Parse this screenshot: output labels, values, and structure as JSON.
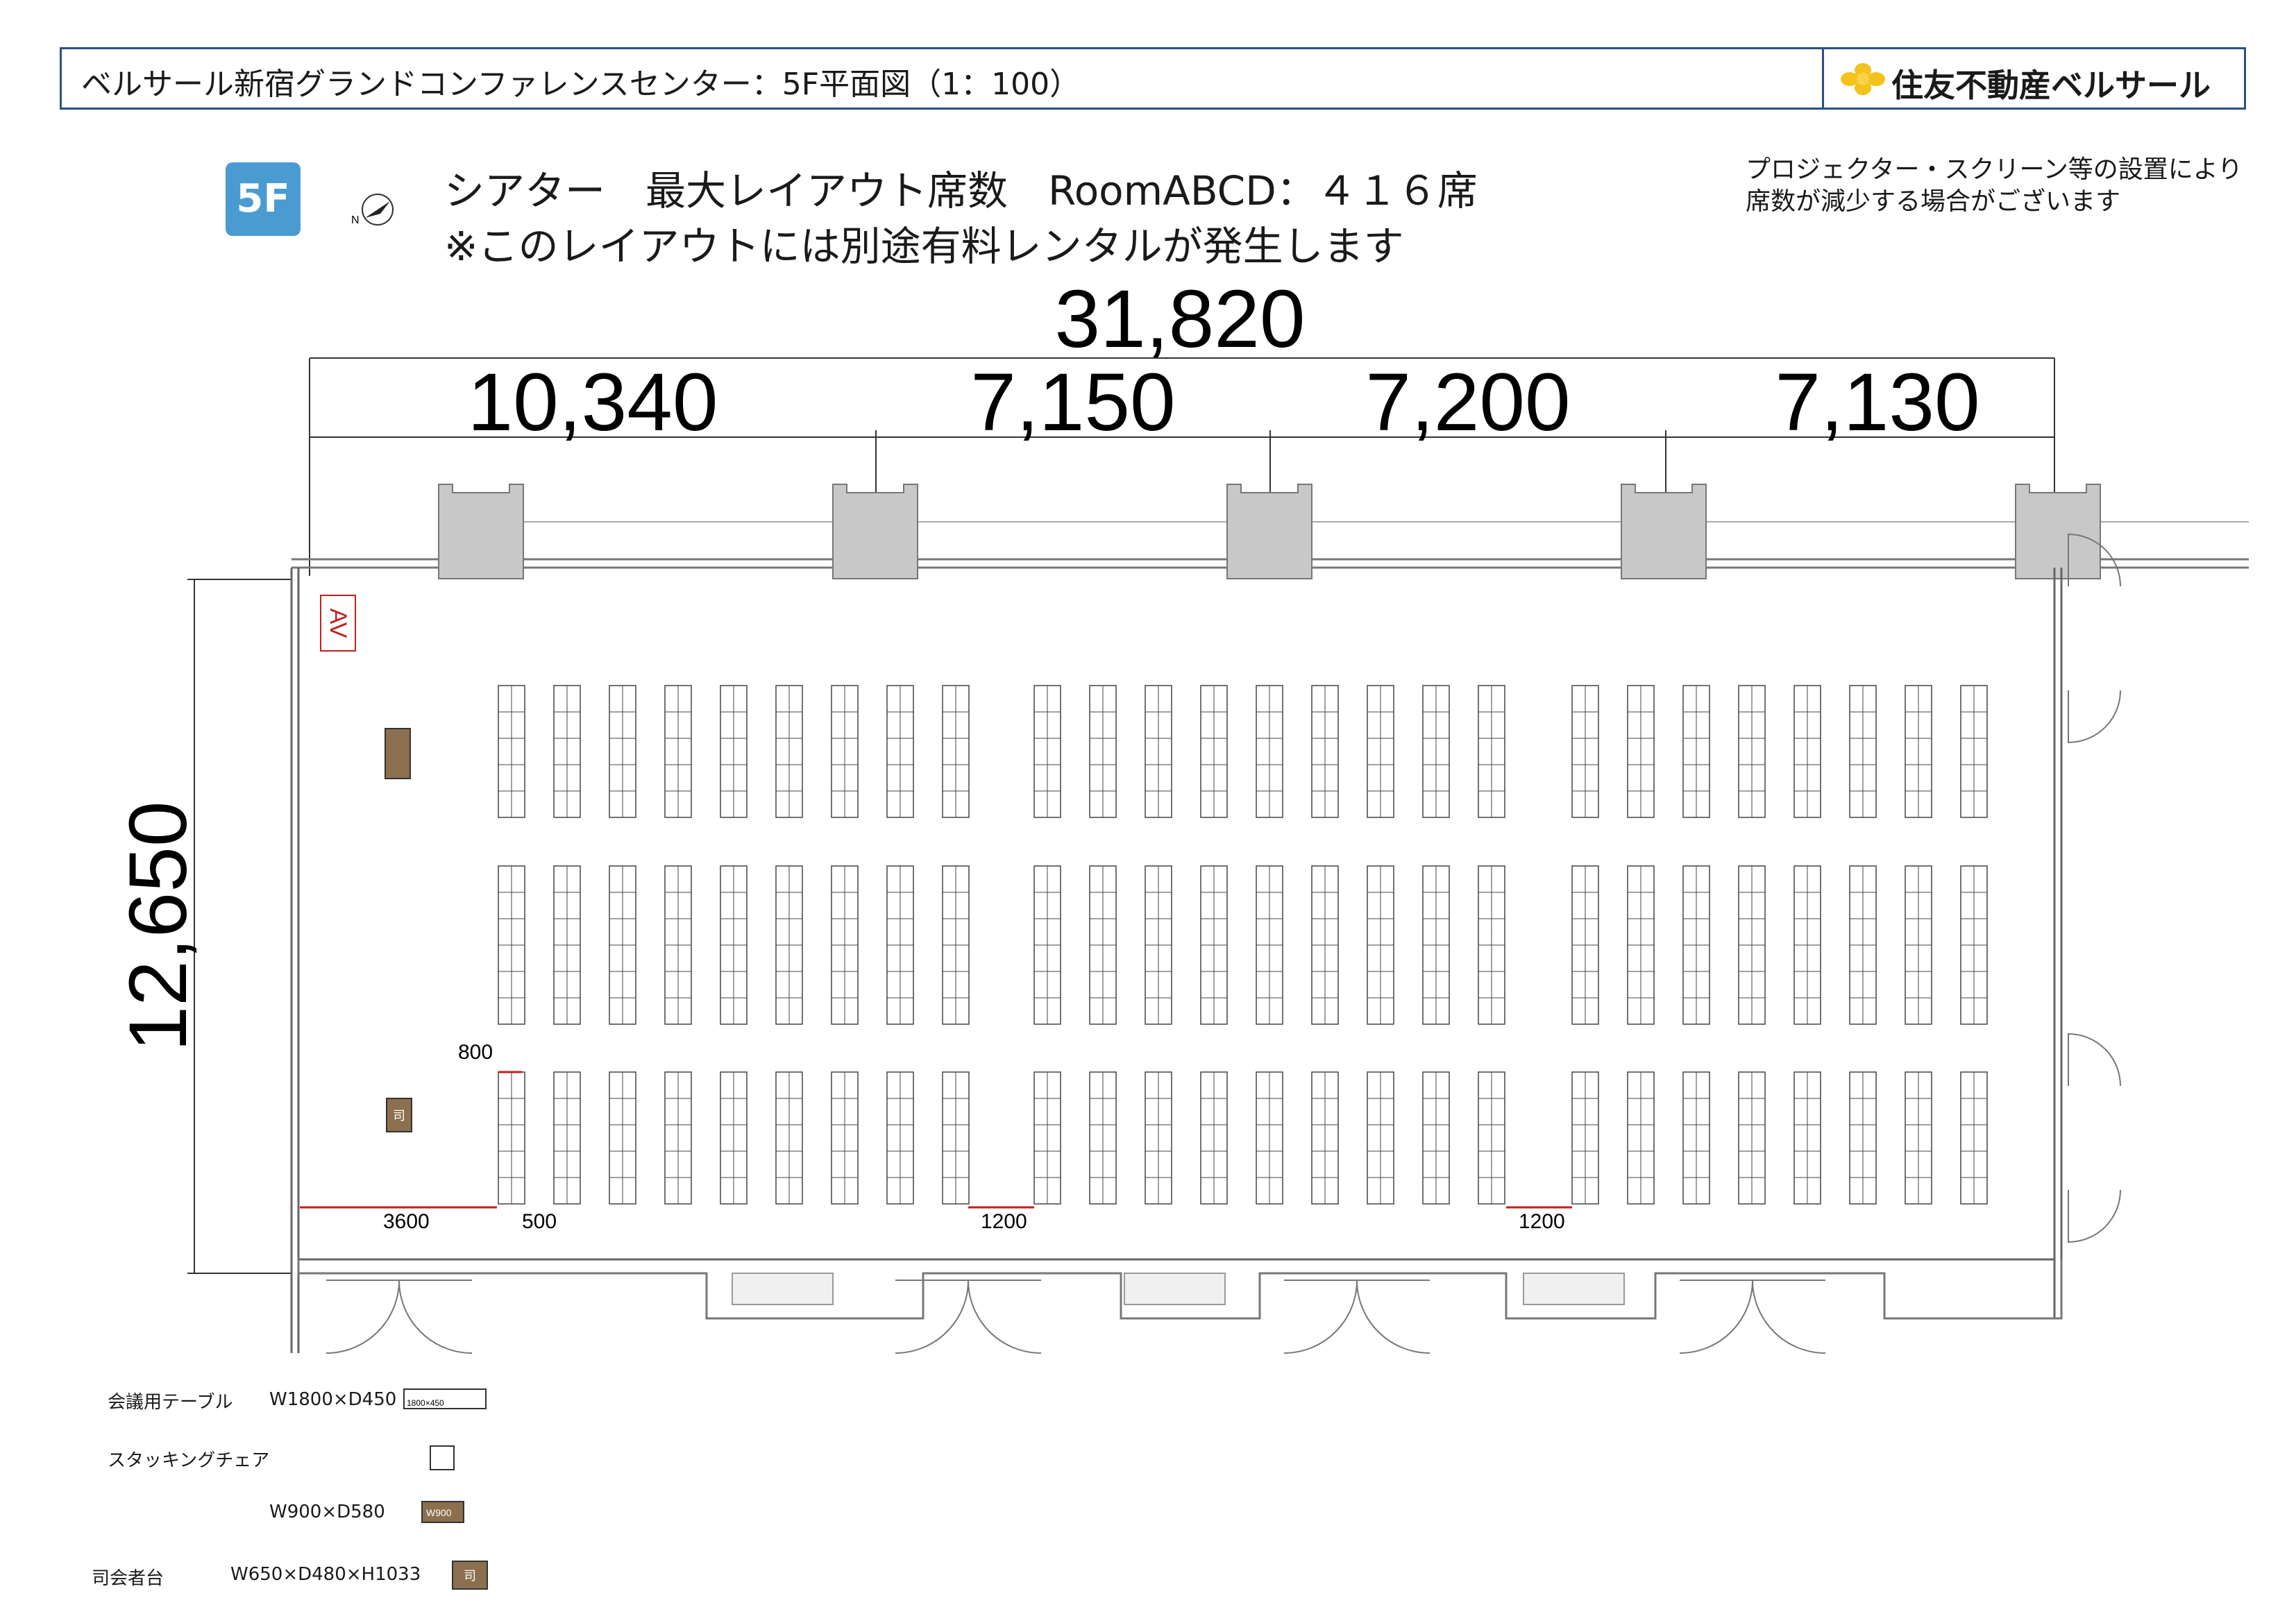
{
  "header": {
    "title": "ベルサール新宿グランドコンファレンスセンター：5F平面図（1：100）",
    "brand": "住友不動産ベルサール"
  },
  "floor_badge": "5F",
  "compass_label": "N",
  "headline": {
    "line1": "シアター　最大レイアウト席数　RoomABCD：４１６席",
    "line2": "※このレイアウトには別途有料レンタルが発生します"
  },
  "note": {
    "line1": "プロジェクター・スクリーン等の設置により",
    "line2": "席数が減少する場合がございます"
  },
  "dimensions": {
    "total_width": "31,820",
    "sections": [
      "10,340",
      "7,150",
      "7,200",
      "7,130"
    ],
    "height": "12,650",
    "clearances": {
      "aisle_front": "800",
      "front_space": "3600",
      "edge_gap": "500",
      "aisle_1": "1200",
      "aisle_2": "1200"
    }
  },
  "room": {
    "av_label": "AV",
    "podium_label": "司"
  },
  "legend": {
    "table": {
      "name": "会議用テーブル",
      "size": "W1800×D450",
      "symbol_text": "1800×450"
    },
    "chair": {
      "name": "スタッキングチェア"
    },
    "stage": {
      "size": "W900×D580",
      "symbol_text": "W900"
    },
    "podium": {
      "name": "司会者台",
      "size": "W650×D480×H1033",
      "symbol_text": "司"
    }
  },
  "colors": {
    "header_border": "#2b4f86",
    "badge": "#4a9bd1",
    "pillar": "#c8c8c8",
    "red_mark": "#c0201c",
    "podium": "#8b6f4e",
    "brand_icon": "#f3c21b"
  }
}
